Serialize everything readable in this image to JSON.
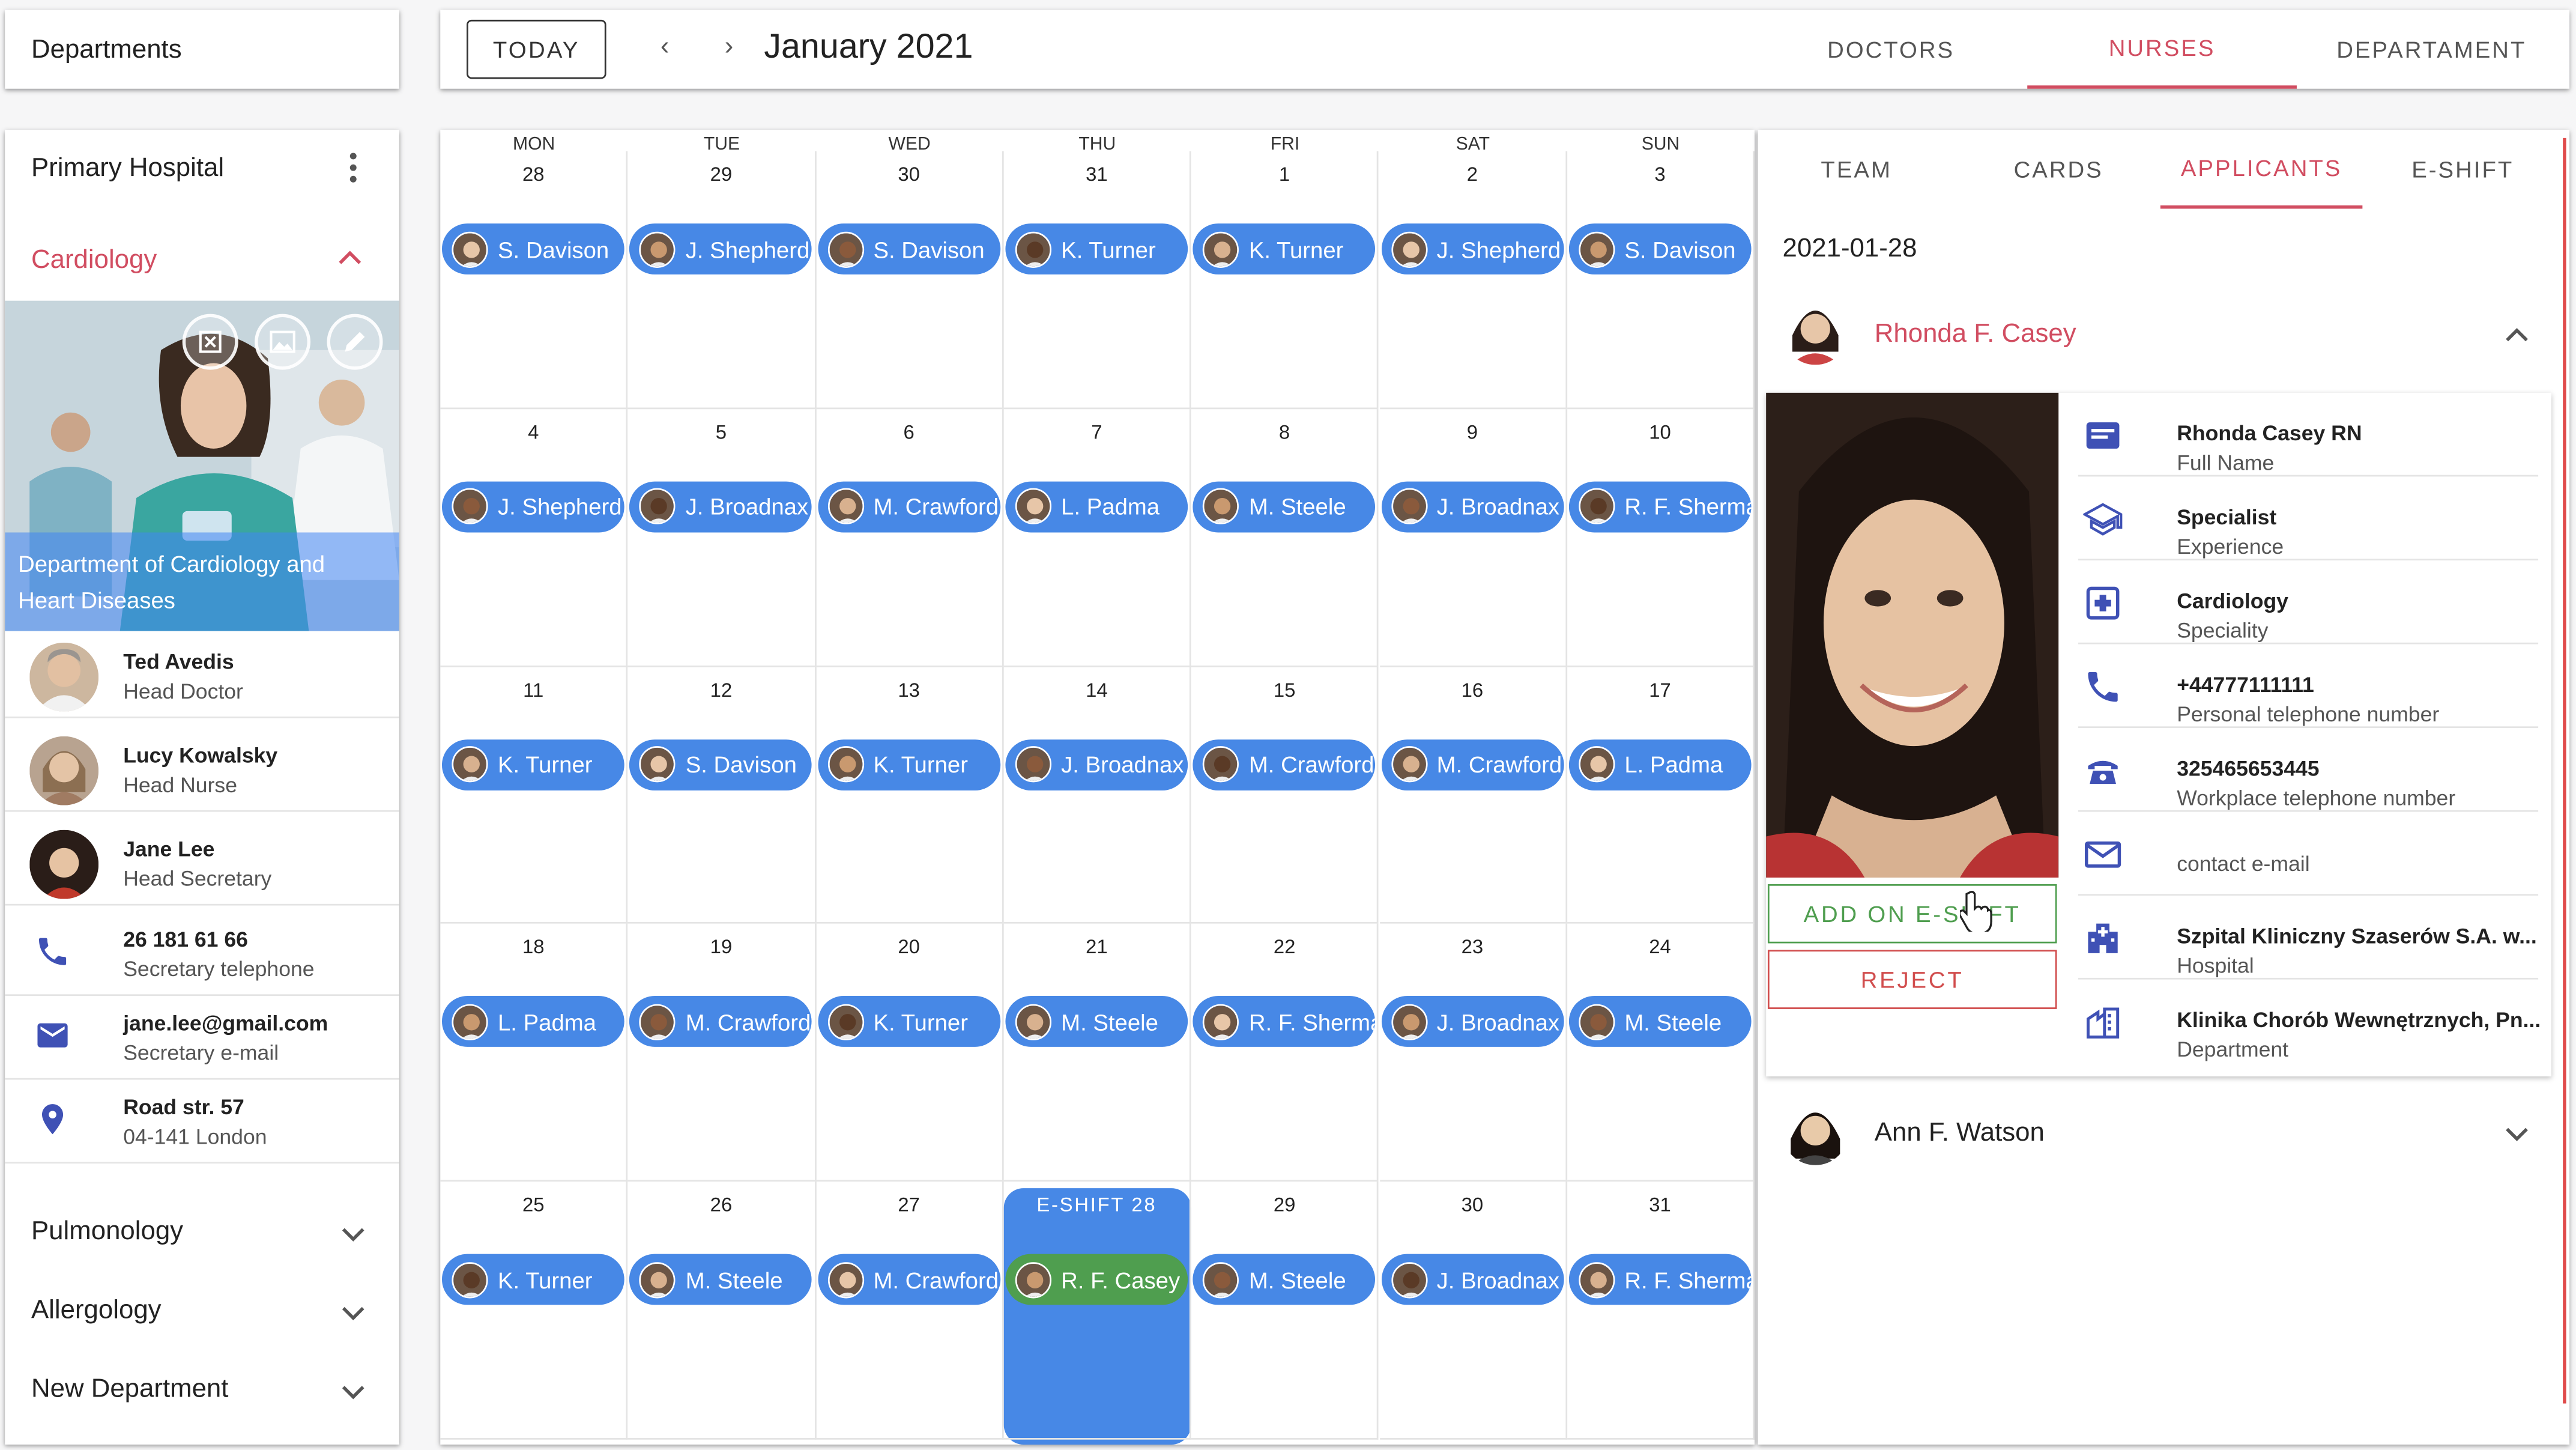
{
  "sidebar": {
    "header": "Departments",
    "hospital": "Primary Hospital",
    "active_department": "Cardiology",
    "photo_caption": "Department of Cardiology and Heart Diseases",
    "staff": [
      {
        "name": "Ted Avedis",
        "role": "Head Doctor"
      },
      {
        "name": "Lucy Kowalsky",
        "role": "Head Nurse"
      },
      {
        "name": "Jane Lee",
        "role": "Head Secretary"
      }
    ],
    "contacts": [
      {
        "icon": "phone-icon",
        "value": "26 181 61 66",
        "label": "Secretary telephone"
      },
      {
        "icon": "email-icon",
        "value": "jane.lee@gmail.com",
        "label": "Secretary e-mail"
      },
      {
        "icon": "location-pin-icon",
        "value": "Road str. 57",
        "label": "04-141 London"
      }
    ],
    "departments": [
      "Pulmonology",
      "Allergology",
      "New Department"
    ]
  },
  "topbar": {
    "today_label": "TODAY",
    "prev_icon": "‹",
    "next_icon": "›",
    "month": "January 2021",
    "tabs": [
      "DOCTORS",
      "NURSES",
      "DEPARTAMENT"
    ],
    "active_tab": "NURSES"
  },
  "calendar": {
    "weekdays": [
      "MON",
      "TUE",
      "WED",
      "THU",
      "FRI",
      "SAT",
      "SUN"
    ],
    "weeks": [
      [
        {
          "d": "28",
          "n": "S. Davison"
        },
        {
          "d": "29",
          "n": "J. Shepherd"
        },
        {
          "d": "30",
          "n": "S. Davison"
        },
        {
          "d": "31",
          "n": "K. Turner"
        },
        {
          "d": "1",
          "n": "K. Turner"
        },
        {
          "d": "2",
          "n": "J. Shepherd"
        },
        {
          "d": "3",
          "n": "S. Davison"
        }
      ],
      [
        {
          "d": "4",
          "n": "J. Shepherd"
        },
        {
          "d": "5",
          "n": "J. Broadnax"
        },
        {
          "d": "6",
          "n": "M. Crawford"
        },
        {
          "d": "7",
          "n": "L. Padma"
        },
        {
          "d": "8",
          "n": "M. Steele"
        },
        {
          "d": "9",
          "n": "J. Broadnax"
        },
        {
          "d": "10",
          "n": "R. F. Sherma"
        }
      ],
      [
        {
          "d": "11",
          "n": "K. Turner"
        },
        {
          "d": "12",
          "n": "S. Davison"
        },
        {
          "d": "13",
          "n": "K. Turner"
        },
        {
          "d": "14",
          "n": "J. Broadnax"
        },
        {
          "d": "15",
          "n": "M. Crawford"
        },
        {
          "d": "16",
          "n": "M. Crawford"
        },
        {
          "d": "17",
          "n": "L. Padma"
        }
      ],
      [
        {
          "d": "18",
          "n": "L. Padma"
        },
        {
          "d": "19",
          "n": "M. Crawford"
        },
        {
          "d": "20",
          "n": "K. Turner"
        },
        {
          "d": "21",
          "n": "M. Steele"
        },
        {
          "d": "22",
          "n": "R. F. Sherma"
        },
        {
          "d": "23",
          "n": "J. Broadnax"
        },
        {
          "d": "24",
          "n": "M. Steele"
        }
      ],
      [
        {
          "d": "25",
          "n": "K. Turner"
        },
        {
          "d": "26",
          "n": "M. Steele"
        },
        {
          "d": "27",
          "n": "M. Crawford"
        },
        {
          "d": "E-SHIFT 28",
          "n": "R. F. Casey"
        },
        {
          "d": "29",
          "n": "M. Steele"
        },
        {
          "d": "30",
          "n": "J. Broadnax"
        },
        {
          "d": "31",
          "n": "R. F. Sherma"
        }
      ]
    ]
  },
  "panel": {
    "tabs": [
      "TEAM",
      "CARDS",
      "APPLICANTS",
      "E-SHIFT"
    ],
    "active_tab": "APPLICANTS",
    "date": "2021-01-28",
    "applicant1": "Rhonda F. Casey",
    "applicant2": "Ann F. Watson",
    "add_label": "ADD ON E-SHIFT",
    "reject_label": "REJECT",
    "details": [
      {
        "icon": "id-card-icon",
        "value": "Rhonda Casey RN",
        "label": "Full Name"
      },
      {
        "icon": "graduation-cap-icon",
        "value": "Specialist",
        "label": "Experience"
      },
      {
        "icon": "medical-cross-icon",
        "value": "Cardiology",
        "label": "Speciality"
      },
      {
        "icon": "phone-icon",
        "value": "+44777111111",
        "label": "Personal telephone number"
      },
      {
        "icon": "desk-phone-icon",
        "value": "325465653445",
        "label": "Workplace telephone number"
      },
      {
        "icon": "email-icon",
        "value": "",
        "label": "contact e-mail"
      },
      {
        "icon": "hospital-building-icon",
        "value": "Szpital Kliniczny Szaserów S.A. w...",
        "label": "Hospital"
      },
      {
        "icon": "department-building-icon",
        "value": "Klinika Chorób Wewnętrznych, Pn...",
        "label": "Department"
      }
    ]
  },
  "colors": {
    "accent": "#d14d61",
    "chip": "#4788e6",
    "chip_selected": "#4f9e4f",
    "icon": "#3f51b5"
  }
}
